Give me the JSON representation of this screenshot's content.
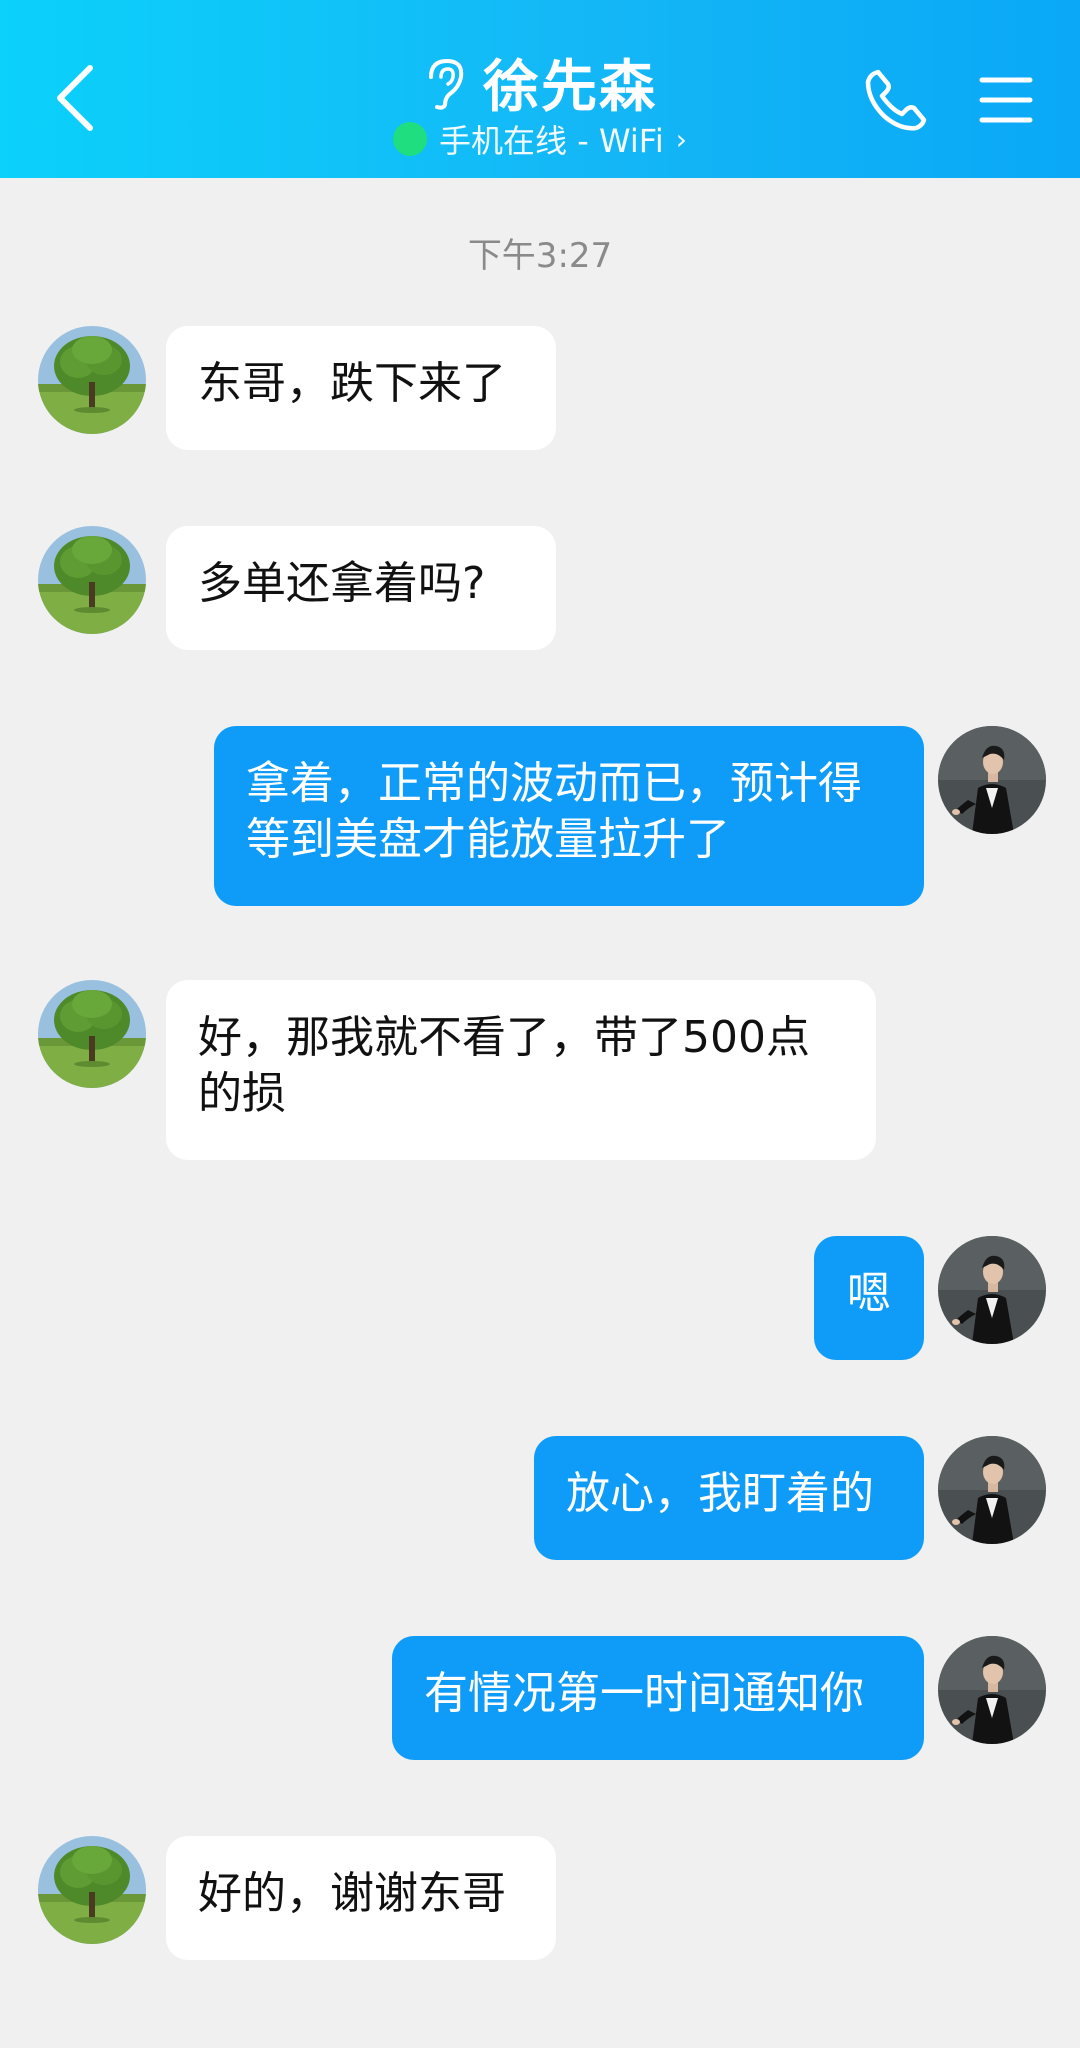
{
  "header": {
    "contact_name": "徐先森",
    "status": "手机在线 - WiFi",
    "status_chevron": "›",
    "icons": [
      "chevron-left-icon",
      "ear-icon",
      "phone-icon",
      "menu-icon"
    ],
    "gradient": [
      "#0bd1fb",
      "#0aa8f7"
    ],
    "online_color": "#1fe07a"
  },
  "chat": {
    "time": "下午3:27",
    "messages": [
      {
        "from": "contact",
        "text": "东哥，跌下来了"
      },
      {
        "from": "contact",
        "text": "多单还拿着吗?"
      },
      {
        "from": "me",
        "text": "拿着，正常的波动而已，预计得等到美盘才能放量拉升了"
      },
      {
        "from": "contact",
        "text": "好，那我就不看了，带了500点的损"
      },
      {
        "from": "me",
        "text": "嗯"
      },
      {
        "from": "me",
        "text": "放心，我盯着的"
      },
      {
        "from": "me",
        "text": "有情况第一时间通知你"
      },
      {
        "from": "contact",
        "text": "好的，谢谢东哥"
      }
    ],
    "bubble_colors": {
      "incoming": "#ffffff",
      "outgoing": "#0f9bf8"
    }
  }
}
